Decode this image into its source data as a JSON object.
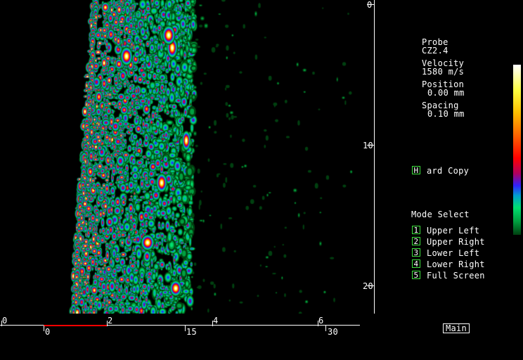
{
  "depth_axis": {
    "labels": [
      "0",
      "10",
      "20"
    ]
  },
  "horizontal_axis": {
    "upper_labels": [
      "0",
      "2",
      "4",
      "6"
    ],
    "lower_labels": [
      "0",
      "15",
      "30"
    ]
  },
  "probe": {
    "label": "Probe",
    "value": "CZ2.4"
  },
  "velocity": {
    "label": "Velocity",
    "value": "1580 m/s"
  },
  "position": {
    "label": "Position",
    "value": "0.00 mm"
  },
  "spacing": {
    "label": "Spacing",
    "value": "0.10 mm"
  },
  "hard_copy": {
    "key": "H",
    "label": "ard Copy"
  },
  "mode_select": {
    "title": "Mode Select",
    "items": [
      {
        "key": "1",
        "label": "Upper Left"
      },
      {
        "key": "2",
        "label": "Upper Right"
      },
      {
        "key": "3",
        "label": "Lower Left"
      },
      {
        "key": "4",
        "label": "Lower Right"
      },
      {
        "key": "5",
        "label": "Full Screen"
      }
    ]
  },
  "main_button": {
    "label": "Main"
  },
  "colors": {
    "key_border": "#3ce03c",
    "axis": "#ffffff",
    "highlight": "#ff0000"
  },
  "colormap": [
    "#004010",
    "#00a040",
    "#00e070",
    "#00a0d0",
    "#3020ff",
    "#b00060",
    "#ff0000",
    "#ff6000",
    "#ffc000",
    "#ffff40",
    "#ffffd0",
    "#ffffff"
  ]
}
